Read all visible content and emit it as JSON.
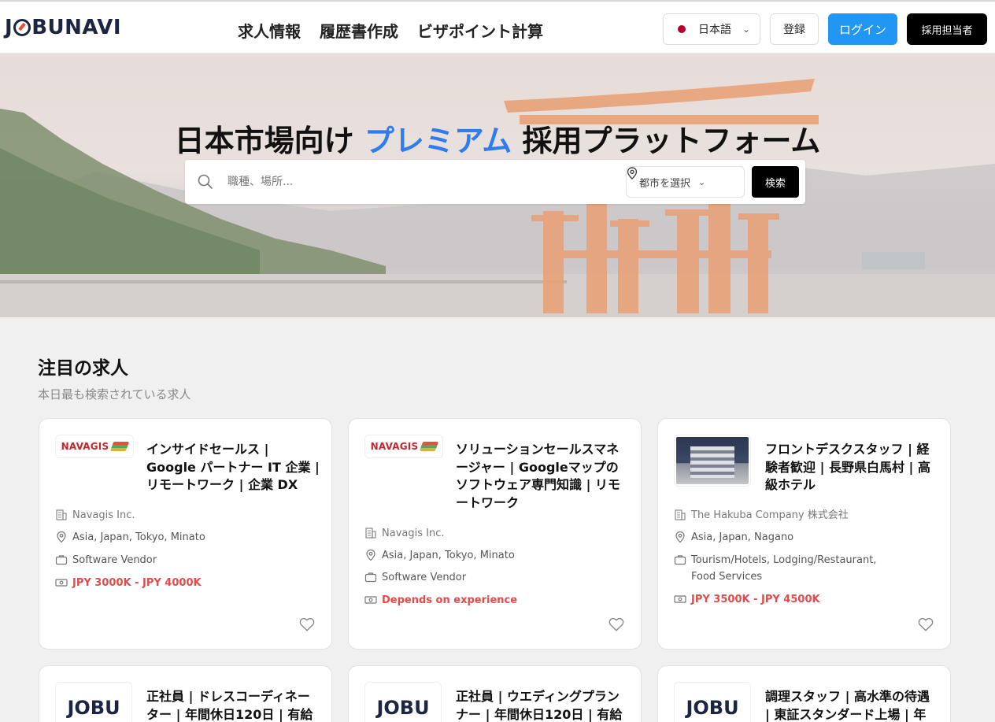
{
  "header": {
    "logo": "JOBUNAVI",
    "nav": [
      "求人情報",
      "履歴書作成",
      "ビザポイント計算"
    ],
    "language": "日本語",
    "register_label": "登録",
    "login_label": "ログイン",
    "recruiter_label": "採用担当者"
  },
  "hero": {
    "title_before": "日本市場向け ",
    "title_accent": "プレミアム",
    "title_after": " 採用プラットフォーム",
    "search_placeholder": "職種、場所...",
    "city_label": "都市を選択",
    "search_button": "検索"
  },
  "section": {
    "title": "注目の求人",
    "subtitle": "本日最も検索されている求人"
  },
  "jobs": [
    {
      "logo": "NAVAGIS",
      "title": "インサイドセールス | Google パートナー IT 企業 | リモートワーク | 企業 DX",
      "company": "Navagis Inc.",
      "location": "Asia, Japan, Tokyo, Minato",
      "industry": "Software Vendor",
      "salary": "JPY 3000K - JPY 4000K"
    },
    {
      "logo": "NAVAGIS",
      "title": "ソリューションセールスマネージャー | Googleマップのソフトウェア専門知識 | リモートワーク",
      "company": "Navagis Inc.",
      "location": "Asia, Japan, Tokyo, Minato",
      "industry": "Software Vendor",
      "salary": "Depends on experience"
    },
    {
      "logo": "hotel-photo",
      "title": "フロントデスクスタッフ | 経験者歓迎 | 長野県白馬村 | 高級ホテル",
      "company": "The Hakuba Company 株式会社",
      "location": "Asia, Japan, Nagano",
      "industry": "Tourism/Hotels, Lodging/Restaurant, Food Services",
      "salary": "JPY 3500K - JPY 4500K"
    },
    {
      "logo": "JOBU",
      "title": "正社員 | ドレスコーディネーター | 年間休日120日 | 有給"
    },
    {
      "logo": "JOBU",
      "title": "正社員 | ウエディングプランナー | 年間休日120日 | 有給"
    },
    {
      "logo": "JOBU",
      "title": "調理スタッフ | 高水準の待遇 | 東証スタンダード上場 | 年"
    }
  ],
  "colors": {
    "accent": "#2f7bf0",
    "login": "#2196f3",
    "salary": "#e24b4b"
  }
}
